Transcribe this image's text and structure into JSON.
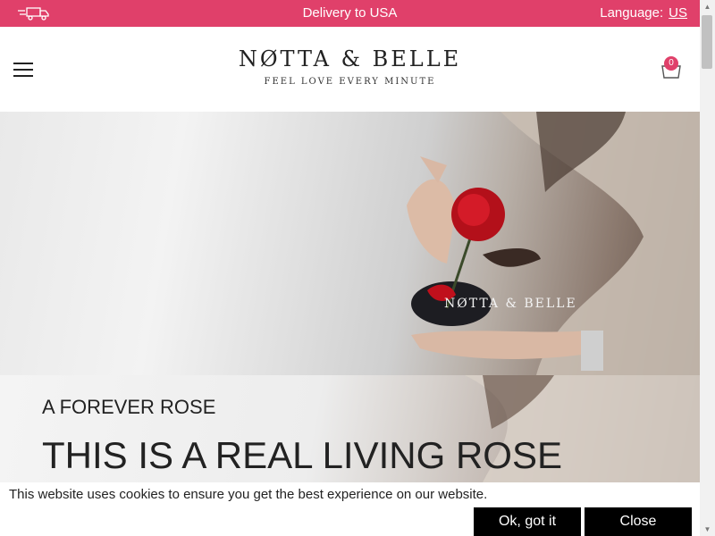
{
  "topbar": {
    "delivery_text": "Delivery to USA",
    "language_label": "Language:",
    "language_code": "US",
    "icon": "truck-icon",
    "bg_color": "#e0406a"
  },
  "header": {
    "logo_name": "NØTTA & BELLE",
    "tagline": "FEEL LOVE EVERY MINUTE",
    "menu_icon": "hamburger-menu-icon",
    "cart_icon": "shopping-bag-icon",
    "cart_count": "0"
  },
  "hero": {
    "watermark": "NØTTA & BELLE"
  },
  "section2": {
    "label": "A FOREVER ROSE",
    "heading": "THIS IS A REAL LIVING ROSE"
  },
  "cookie": {
    "message": "This website uses cookies to ensure you get the best experience on our website.",
    "accept_label": "Ok, got it",
    "close_label": "Close"
  }
}
